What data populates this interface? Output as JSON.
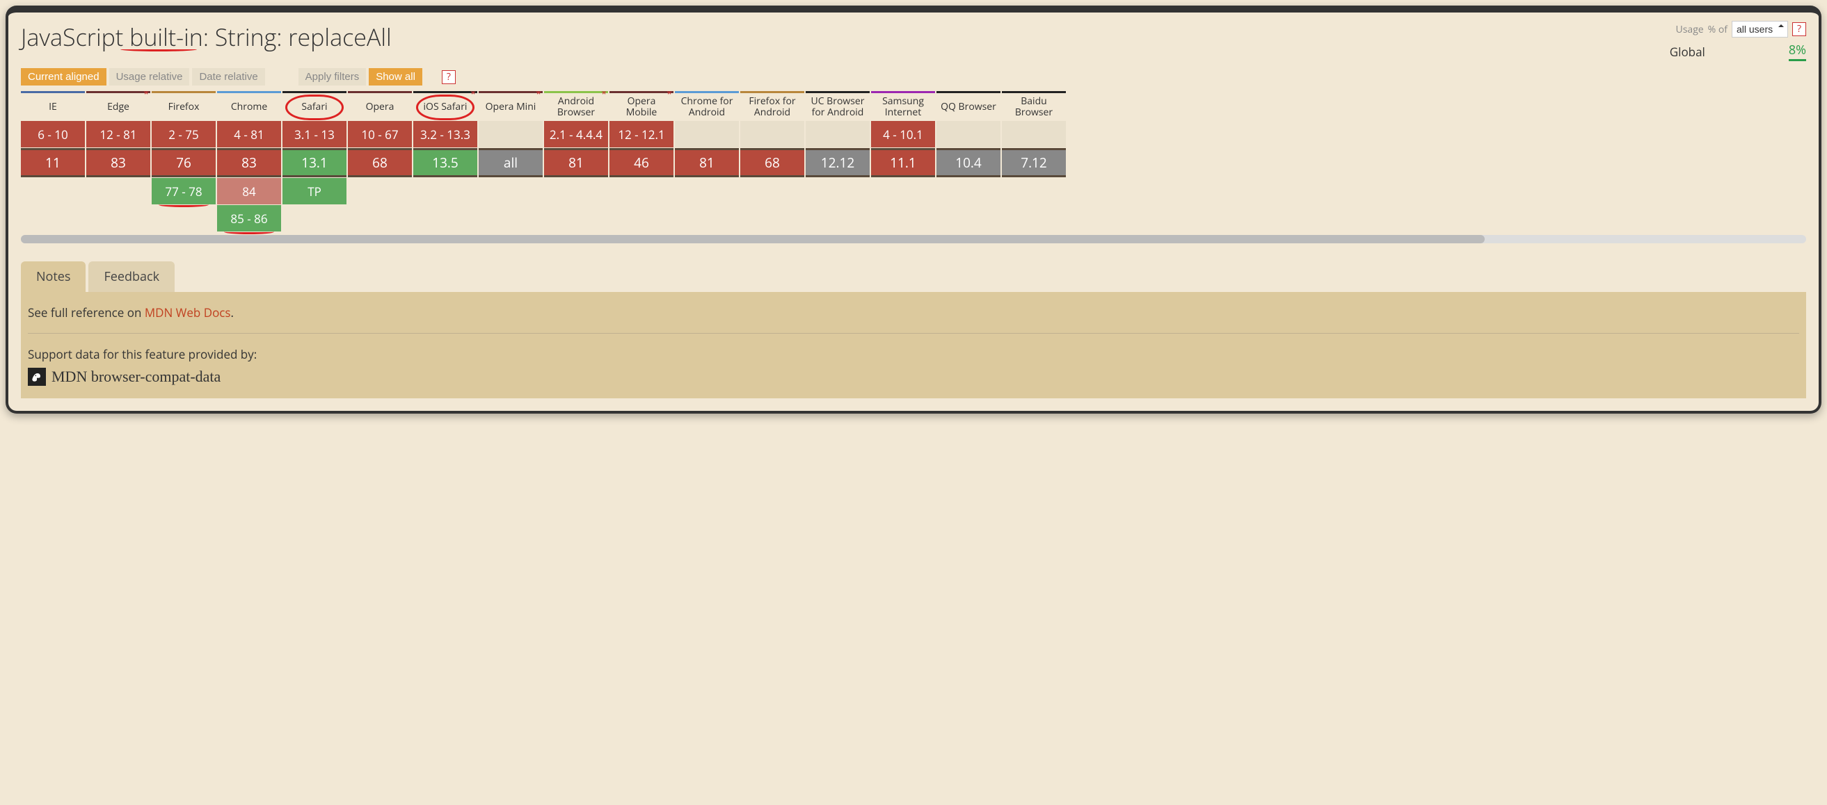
{
  "title": "JavaScript built-in: String: replaceAll",
  "usage": {
    "label": "Usage",
    "percent_of": "% of",
    "select_value": "all users",
    "help": "?",
    "global_label": "Global",
    "global_percent": "8%"
  },
  "toolbar": {
    "current_aligned": "Current aligned",
    "usage_relative": "Usage relative",
    "date_relative": "Date relative",
    "apply_filters": "Apply filters",
    "show_all": "Show all",
    "help": "?"
  },
  "browsers": [
    {
      "name": "IE",
      "accent": "accent-blue",
      "star": false,
      "circled": false,
      "past": [
        {
          "v": "6 - 10",
          "s": "no"
        }
      ],
      "current": {
        "v": "11",
        "s": "no"
      },
      "future": []
    },
    {
      "name": "Edge",
      "accent": "accent-darkred",
      "star": true,
      "circled": false,
      "past": [
        {
          "v": "12 - 81",
          "s": "no"
        }
      ],
      "current": {
        "v": "83",
        "s": "no"
      },
      "future": []
    },
    {
      "name": "Firefox",
      "accent": "accent-orange",
      "star": false,
      "circled": false,
      "past": [
        {
          "v": "2 - 75",
          "s": "no"
        }
      ],
      "current": {
        "v": "76",
        "s": "no"
      },
      "future": [
        {
          "v": "77 - 78",
          "s": "yes",
          "underline": true
        }
      ]
    },
    {
      "name": "Chrome",
      "accent": "accent-lightblue",
      "star": false,
      "circled": false,
      "past": [
        {
          "v": "4 - 81",
          "s": "no"
        }
      ],
      "current": {
        "v": "83",
        "s": "no"
      },
      "future": [
        {
          "v": "84",
          "s": "partial"
        },
        {
          "v": "85 - 86",
          "s": "yes",
          "underline": true
        }
      ]
    },
    {
      "name": "Safari",
      "accent": "accent-black",
      "star": false,
      "circled": true,
      "past": [
        {
          "v": "3.1 - 13",
          "s": "no"
        }
      ],
      "current": {
        "v": "13.1",
        "s": "yes"
      },
      "future": [
        {
          "v": "TP",
          "s": "yes"
        }
      ]
    },
    {
      "name": "Opera",
      "accent": "accent-darkred",
      "star": false,
      "circled": false,
      "past": [
        {
          "v": "10 - 67",
          "s": "no"
        }
      ],
      "current": {
        "v": "68",
        "s": "no"
      },
      "future": []
    },
    {
      "name": "iOS Safari",
      "accent": "accent-black",
      "star": true,
      "circled": true,
      "past": [
        {
          "v": "3.2 - 13.3",
          "s": "no"
        }
      ],
      "current": {
        "v": "13.5",
        "s": "yes"
      },
      "future": []
    },
    {
      "name": "Opera Mini",
      "accent": "accent-darkred",
      "star": true,
      "circled": false,
      "past": [
        {
          "v": "",
          "s": "empty"
        }
      ],
      "current": {
        "v": "all",
        "s": "unknown"
      },
      "future": []
    },
    {
      "name": "Android Browser",
      "accent": "accent-green",
      "star": true,
      "circled": false,
      "past": [
        {
          "v": "2.1 - 4.4.4",
          "s": "no"
        }
      ],
      "current": {
        "v": "81",
        "s": "no"
      },
      "future": []
    },
    {
      "name": "Opera Mobile",
      "accent": "accent-darkred",
      "star": true,
      "circled": false,
      "past": [
        {
          "v": "12 - 12.1",
          "s": "no"
        }
      ],
      "current": {
        "v": "46",
        "s": "no"
      },
      "future": []
    },
    {
      "name": "Chrome for Android",
      "accent": "accent-lightblue",
      "star": false,
      "circled": false,
      "past": [
        {
          "v": "",
          "s": "empty"
        }
      ],
      "current": {
        "v": "81",
        "s": "no"
      },
      "future": []
    },
    {
      "name": "Firefox for Android",
      "accent": "accent-orange",
      "star": false,
      "circled": false,
      "past": [
        {
          "v": "",
          "s": "empty"
        }
      ],
      "current": {
        "v": "68",
        "s": "no"
      },
      "future": []
    },
    {
      "name": "UC Browser for Android",
      "accent": "accent-black",
      "star": false,
      "circled": false,
      "past": [
        {
          "v": "",
          "s": "empty"
        }
      ],
      "current": {
        "v": "12.12",
        "s": "unknown"
      },
      "future": []
    },
    {
      "name": "Samsung Internet",
      "accent": "accent-purple",
      "star": false,
      "circled": false,
      "past": [
        {
          "v": "4 - 10.1",
          "s": "no"
        }
      ],
      "current": {
        "v": "11.1",
        "s": "no"
      },
      "future": []
    },
    {
      "name": "QQ Browser",
      "accent": "accent-black",
      "star": false,
      "circled": false,
      "past": [
        {
          "v": "",
          "s": "empty"
        }
      ],
      "current": {
        "v": "10.4",
        "s": "unknown"
      },
      "future": []
    },
    {
      "name": "Baidu Browser",
      "accent": "accent-black",
      "star": false,
      "circled": false,
      "past": [
        {
          "v": "",
          "s": "empty"
        }
      ],
      "current": {
        "v": "7.12",
        "s": "unknown"
      },
      "future": []
    }
  ],
  "tabs": {
    "notes": "Notes",
    "feedback": "Feedback"
  },
  "notes": {
    "text_before": "See full reference on ",
    "link_text": "MDN Web Docs",
    "text_after": ".",
    "support_label": "Support data for this feature provided by:",
    "source_name": "MDN browser-compat-data"
  }
}
